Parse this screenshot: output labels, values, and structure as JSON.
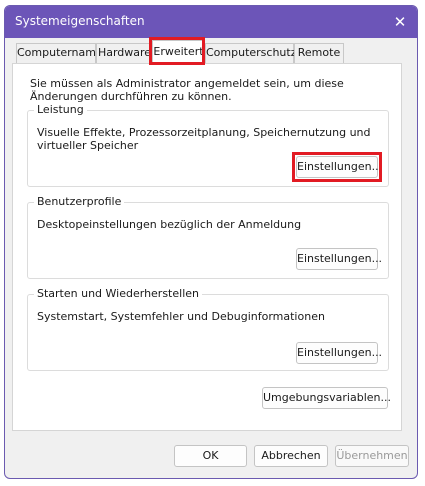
{
  "window": {
    "title": "Systemeigenschaften"
  },
  "icons": {
    "close": "close-icon"
  },
  "tabs": [
    {
      "label": "Computername",
      "active": false
    },
    {
      "label": "Hardware",
      "active": false
    },
    {
      "label": "Erweitert",
      "active": true
    },
    {
      "label": "Computerschutz",
      "active": false
    },
    {
      "label": "Remote",
      "active": false
    }
  ],
  "intro": "Sie müssen als Administrator angemeldet sein, um diese Änderungen durchführen zu können.",
  "groups": [
    {
      "title": "Leistung",
      "description": "Visuelle Effekte, Prozessorzeitplanung, Speichernutzung und virtueller Speicher",
      "button": "Einstellungen..."
    },
    {
      "title": "Benutzerprofile",
      "description": "Desktopeinstellungen bezüglich der Anmeldung",
      "button": "Einstellungen..."
    },
    {
      "title": "Starten und Wiederherstellen",
      "description": "Systemstart, Systemfehler und Debuginformationen",
      "button": "Einstellungen..."
    }
  ],
  "env_button": "Umgebungsvariablen...",
  "footer": {
    "ok": "OK",
    "cancel": "Abbrechen",
    "apply": "Übernehmen"
  },
  "colors": {
    "titlebar": "#6c55b8",
    "highlight": "#e21b23"
  }
}
